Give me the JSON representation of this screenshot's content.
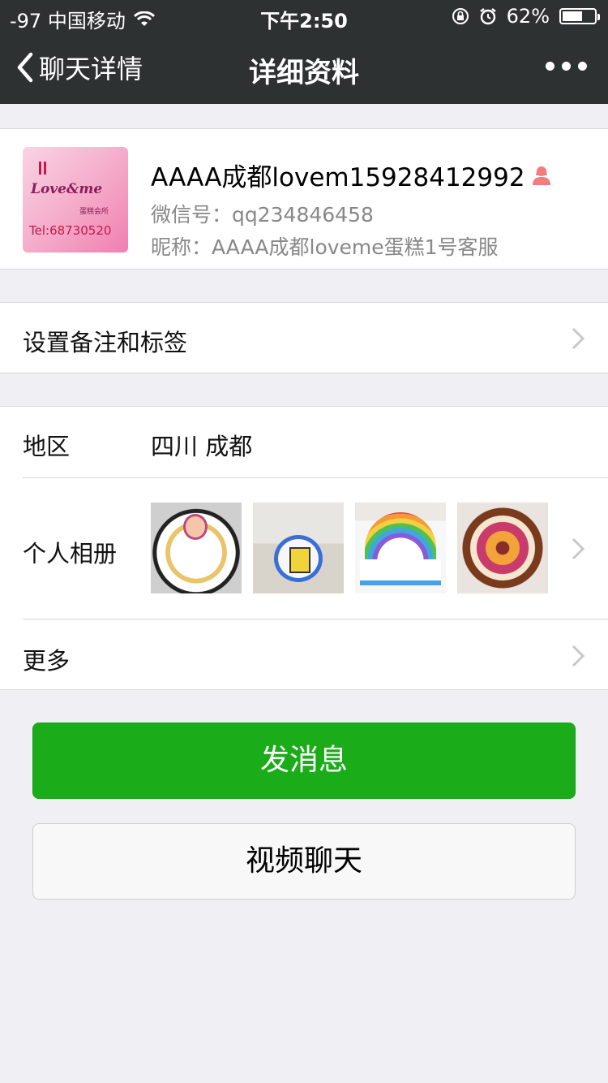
{
  "status_bar": {
    "carrier": "-97 中国移动",
    "time": "下午2:50",
    "battery_percent": "62%",
    "battery_level": 0.62
  },
  "nav": {
    "back_label": "聊天详情",
    "title": "详细资料"
  },
  "profile": {
    "name": "AAAA成都lovem15928412992",
    "wechat_id": "微信号：qq234846458",
    "nickname": "昵称：AAAA成都loveme蛋糕1号客服",
    "avatar": {
      "brand": "Love&me",
      "sub": "蛋糕会所",
      "tel": "Tel:68730520"
    }
  },
  "remark_row": {
    "label": "设置备注和标签"
  },
  "region_row": {
    "label": "地区",
    "value": "四川 成都"
  },
  "album_row": {
    "label": "个人相册",
    "photos": [
      "cake-photo-1",
      "cake-photo-2",
      "cake-photo-3",
      "cake-photo-4"
    ]
  },
  "more_row": {
    "label": "更多"
  },
  "buttons": {
    "send_message": "发消息",
    "video_call": "视频聊天"
  },
  "colors": {
    "nav_bg": "#2e3132",
    "page_bg": "#efeff4",
    "primary_green": "#1aad19",
    "gender_female": "#f37c7c"
  },
  "icons": [
    "wifi-icon",
    "rotation-lock-icon",
    "alarm-icon",
    "battery-icon",
    "back-chevron-icon",
    "more-dots-icon",
    "female-person-icon",
    "chevron-right-icon"
  ]
}
